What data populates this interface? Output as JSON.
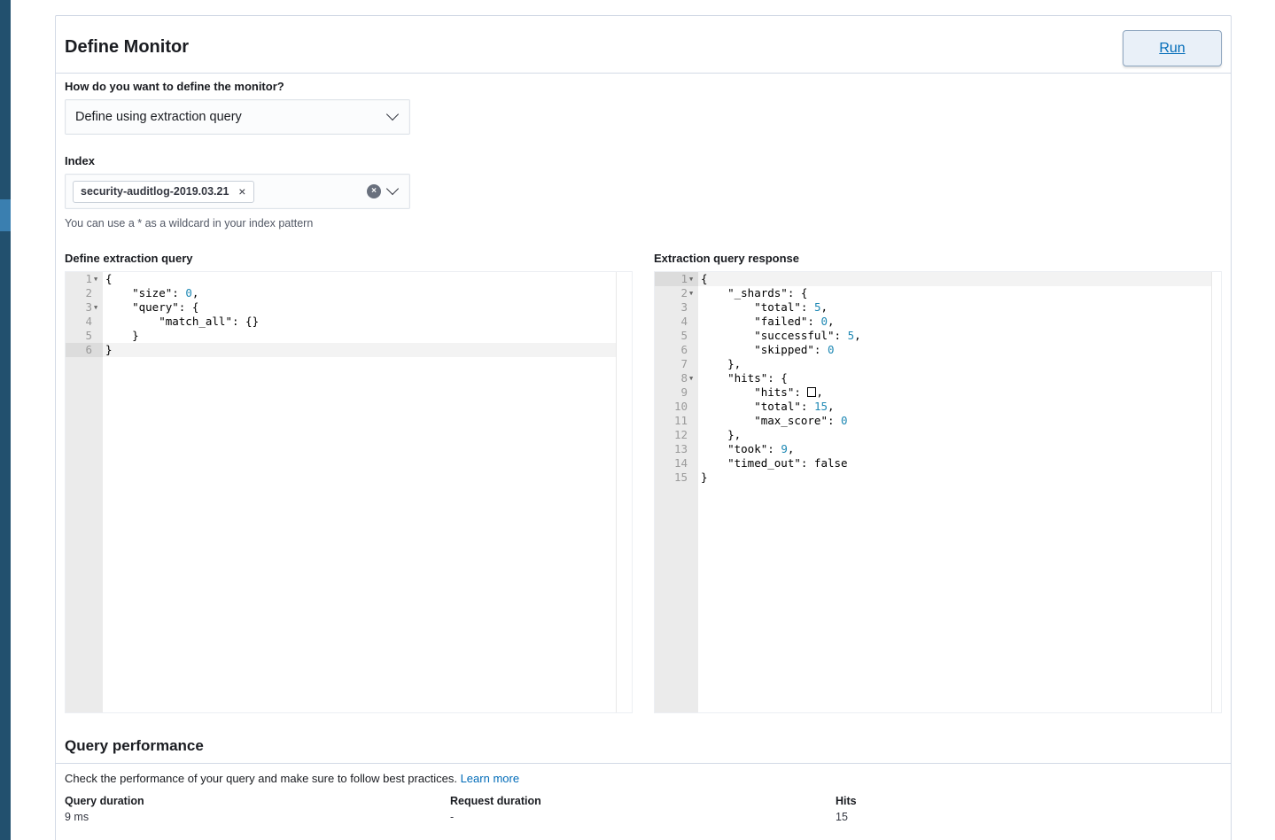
{
  "header": {
    "title": "Define Monitor",
    "run_label": "Run"
  },
  "define_method": {
    "label": "How do you want to define the monitor?",
    "value": "Define using extraction query"
  },
  "index": {
    "label": "Index",
    "selected": "security-auditlog-2019.03.21",
    "help": "You can use a * as a wildcard in your index pattern"
  },
  "query_editor": {
    "label": "Define extraction query",
    "lines": [
      {
        "no": "1",
        "fold": true,
        "segments": [
          {
            "t": "{",
            "c": ""
          }
        ]
      },
      {
        "no": "2",
        "fold": false,
        "segments": [
          {
            "t": "    \"size\": ",
            "c": ""
          },
          {
            "t": "0",
            "c": "num"
          },
          {
            "t": ",",
            "c": ""
          }
        ]
      },
      {
        "no": "3",
        "fold": true,
        "segments": [
          {
            "t": "    \"query\": {",
            "c": ""
          }
        ]
      },
      {
        "no": "4",
        "fold": false,
        "segments": [
          {
            "t": "        \"match_all\": {}",
            "c": ""
          }
        ]
      },
      {
        "no": "5",
        "fold": false,
        "segments": [
          {
            "t": "    }",
            "c": ""
          }
        ]
      },
      {
        "no": "6",
        "fold": false,
        "segments": [
          {
            "t": "}",
            "c": ""
          }
        ]
      }
    ]
  },
  "response_editor": {
    "label": "Extraction query response",
    "lines": [
      {
        "no": "1",
        "fold": true,
        "segments": [
          {
            "t": "{",
            "c": ""
          }
        ]
      },
      {
        "no": "2",
        "fold": true,
        "segments": [
          {
            "t": "    \"_shards\": {",
            "c": ""
          }
        ]
      },
      {
        "no": "3",
        "fold": false,
        "segments": [
          {
            "t": "        \"total\": ",
            "c": ""
          },
          {
            "t": "5",
            "c": "num"
          },
          {
            "t": ",",
            "c": ""
          }
        ]
      },
      {
        "no": "4",
        "fold": false,
        "segments": [
          {
            "t": "        \"failed\": ",
            "c": ""
          },
          {
            "t": "0",
            "c": "num"
          },
          {
            "t": ",",
            "c": ""
          }
        ]
      },
      {
        "no": "5",
        "fold": false,
        "segments": [
          {
            "t": "        \"successful\": ",
            "c": ""
          },
          {
            "t": "5",
            "c": "num"
          },
          {
            "t": ",",
            "c": ""
          }
        ]
      },
      {
        "no": "6",
        "fold": false,
        "segments": [
          {
            "t": "        \"skipped\": ",
            "c": ""
          },
          {
            "t": "0",
            "c": "num"
          }
        ]
      },
      {
        "no": "7",
        "fold": false,
        "segments": [
          {
            "t": "    },",
            "c": ""
          }
        ]
      },
      {
        "no": "8",
        "fold": true,
        "segments": [
          {
            "t": "    \"hits\": {",
            "c": ""
          }
        ]
      },
      {
        "no": "9",
        "fold": false,
        "segments": [
          {
            "t": "        \"hits\": ",
            "c": ""
          },
          {
            "t": "[]",
            "c": "arr"
          },
          {
            "t": ",",
            "c": ""
          }
        ]
      },
      {
        "no": "10",
        "fold": false,
        "segments": [
          {
            "t": "        \"total\": ",
            "c": ""
          },
          {
            "t": "15",
            "c": "num"
          },
          {
            "t": ",",
            "c": ""
          }
        ]
      },
      {
        "no": "11",
        "fold": false,
        "segments": [
          {
            "t": "        \"max_score\": ",
            "c": ""
          },
          {
            "t": "0",
            "c": "num"
          }
        ]
      },
      {
        "no": "12",
        "fold": false,
        "segments": [
          {
            "t": "    },",
            "c": ""
          }
        ]
      },
      {
        "no": "13",
        "fold": false,
        "segments": [
          {
            "t": "    \"took\": ",
            "c": ""
          },
          {
            "t": "9",
            "c": "num"
          },
          {
            "t": ",",
            "c": ""
          }
        ]
      },
      {
        "no": "14",
        "fold": false,
        "segments": [
          {
            "t": "    \"timed_out\": false",
            "c": ""
          }
        ]
      },
      {
        "no": "15",
        "fold": false,
        "segments": [
          {
            "t": "}",
            "c": ""
          }
        ]
      }
    ]
  },
  "performance": {
    "title": "Query performance",
    "description": "Check the performance of your query and make sure to follow best practices.",
    "learn_more": "Learn more",
    "stats": [
      {
        "title": "Query duration",
        "value": "9 ms"
      },
      {
        "title": "Request duration",
        "value": "-"
      },
      {
        "title": "Hits",
        "value": "15"
      }
    ]
  },
  "colors": {
    "accent": "#006bb8",
    "rail": "#22506e",
    "number": "#1e88b4"
  }
}
